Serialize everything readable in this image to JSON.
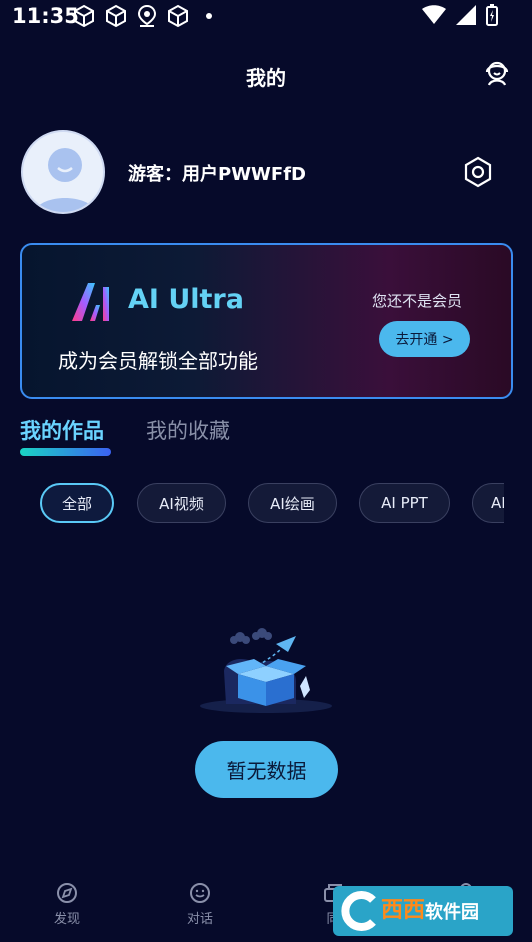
{
  "status_bar": {
    "time": "11:35"
  },
  "header": {
    "title": "我的"
  },
  "profile": {
    "username": "游客：用户PWWFfD"
  },
  "banner": {
    "brand": "AI Ultra",
    "subtitle": "成为会员解锁全部功能",
    "note": "您还不是会员",
    "button_label": "去开通 >"
  },
  "tabs": {
    "active": "我的作品",
    "inactive": "我的收藏"
  },
  "filters": [
    "全部",
    "AI视频",
    "AI绘画",
    "AI PPT",
    "AI"
  ],
  "empty": {
    "button_label": "暂无数据"
  },
  "bottom_nav": [
    "发现",
    "对话",
    "同"
  ],
  "watermark": {
    "cn": "西西",
    "text": "软件园"
  },
  "colors": {
    "background": "#060a2a",
    "accent": "#4bb8ed",
    "tab_active": "#6ad4ff"
  }
}
